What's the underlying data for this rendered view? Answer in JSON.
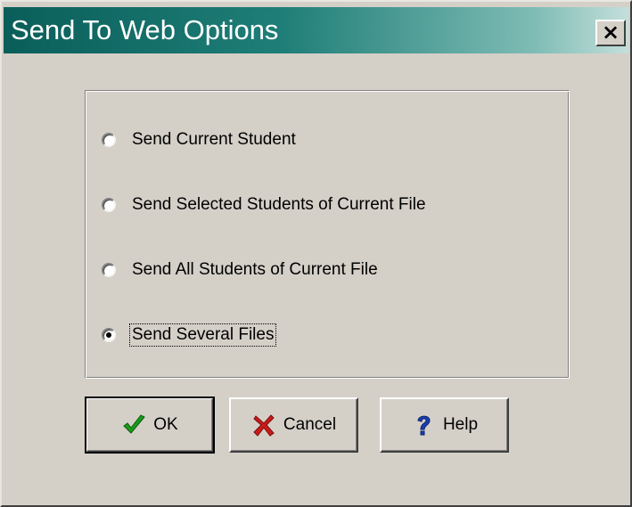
{
  "window": {
    "title": "Send To Web Options",
    "close_glyph": "×",
    "close_icon": "close-icon"
  },
  "options": {
    "selected": "Send Several Files",
    "items": [
      {
        "label": "Send Current Student",
        "checked": false
      },
      {
        "label": "Send Selected Students of Current File",
        "checked": false
      },
      {
        "label": "Send All Students of Current File",
        "checked": false
      },
      {
        "label": "Send Several Files",
        "checked": true
      }
    ]
  },
  "buttons": {
    "ok": {
      "label": "OK",
      "icon": "checkmark-icon",
      "color": "#1a9a1a"
    },
    "cancel": {
      "label": "Cancel",
      "icon": "x-cross-icon",
      "color": "#cc1a1a"
    },
    "help": {
      "label": "Help",
      "icon": "question-mark-icon",
      "color": "#1a3fb0"
    }
  },
  "colors": {
    "dialog_face": "#d4d0c8",
    "title_gradient_start": "#0a5e5a",
    "title_gradient_end": "#c4dfdb",
    "title_text": "#ffffff"
  }
}
